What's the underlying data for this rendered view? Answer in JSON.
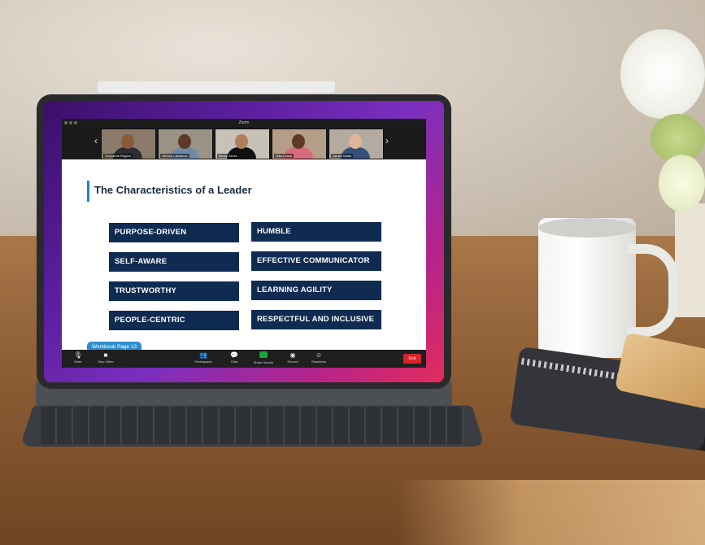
{
  "window": {
    "title": "Zoom"
  },
  "participants": [
    {
      "name": "Sheyanne Rogers",
      "skin": "#8a5a3c",
      "shirt": "#2a2e33",
      "bg": "#8b7b6b"
    },
    {
      "name": "Jeremy Lawrence",
      "skin": "#5b3a27",
      "shirt": "#6f8aa6",
      "bg": "#9a9386"
    },
    {
      "name": "Becky Jones",
      "skin": "#b0805e",
      "shirt": "#111111",
      "bg": "#c7c1b7"
    },
    {
      "name": "Hiba Dubai",
      "skin": "#5d3a28",
      "shirt": "#d76a7c",
      "bg": "#b59e88"
    },
    {
      "name": "James Nolan",
      "skin": "#e2b49a",
      "shirt": "#35507a",
      "bg": "#b3aba0"
    }
  ],
  "slide": {
    "title": "The Characteristics of a Leader",
    "left_traits": [
      "PURPOSE-DRIVEN",
      "SELF-AWARE",
      "TRUSTWORTHY",
      "PEOPLE-CENTRIC"
    ],
    "right_traits": [
      "HUMBLE",
      "EFFECTIVE COMMUNICATOR",
      "LEARNING AGILITY",
      "RESPECTFUL AND INCLUSIVE"
    ],
    "workbook_tab": "Workbook Page 13"
  },
  "toolbar": {
    "mute": "Mute",
    "stop_video": "Stop Video",
    "participants": "Participants",
    "chat": "Chat",
    "share_screen": "Share Screen",
    "record": "Record",
    "reactions": "Reactions",
    "end": "End"
  },
  "colors": {
    "trait_bg": "#0f2b52",
    "accent_blue": "#1c86c4",
    "share_green": "#1aa33e",
    "end_red": "#d8232a"
  },
  "icons": [
    "microphone-icon",
    "video-camera-icon",
    "participants-icon",
    "chat-icon",
    "share-screen-icon",
    "record-icon",
    "reactions-icon",
    "chevron-left-icon",
    "chevron-right-icon"
  ]
}
